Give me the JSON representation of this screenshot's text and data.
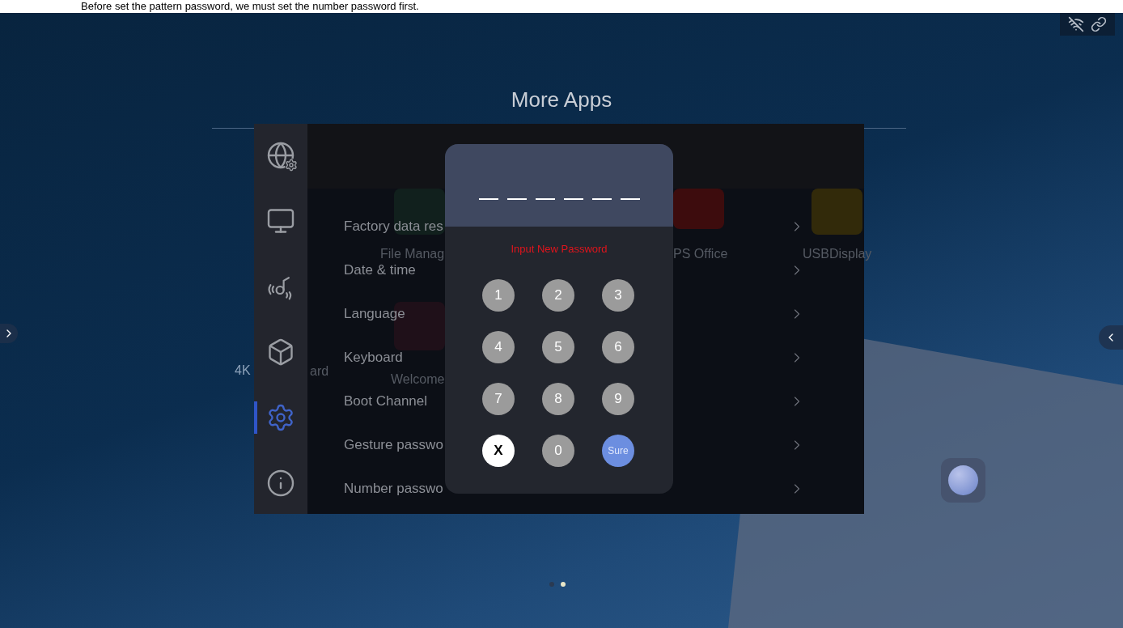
{
  "caption": "Before set the pattern password, we must set the number password first.",
  "screen": {
    "title": "More Apps",
    "background_apps": [
      {
        "label": "File Manag",
        "kind": "files"
      },
      {
        "label": "PS Office",
        "kind": "office"
      },
      {
        "label": "USBDisplay",
        "kind": "display"
      },
      {
        "label": "ard",
        "kind": "text"
      },
      {
        "label": "Welcome",
        "kind": "hand"
      }
    ],
    "wallpaper_label": "4K",
    "settings": {
      "sidebar": [
        {
          "kind": "network",
          "selected": false
        },
        {
          "kind": "display",
          "selected": false
        },
        {
          "kind": "sound",
          "selected": false
        },
        {
          "kind": "apps",
          "selected": false
        },
        {
          "kind": "system",
          "selected": true
        },
        {
          "kind": "about",
          "selected": false
        }
      ],
      "items": [
        "Factory data res",
        "Date & time",
        "Language",
        "Keyboard",
        "Boot Channel",
        "Gesture passwo",
        "Number passwo"
      ]
    },
    "dialog": {
      "prompt": "Input New Password",
      "keys": [
        {
          "label": "1",
          "kind": "digit"
        },
        {
          "label": "2",
          "kind": "digit"
        },
        {
          "label": "3",
          "kind": "digit"
        },
        {
          "label": "4",
          "kind": "digit"
        },
        {
          "label": "5",
          "kind": "digit"
        },
        {
          "label": "6",
          "kind": "digit"
        },
        {
          "label": "7",
          "kind": "digit"
        },
        {
          "label": "8",
          "kind": "digit"
        },
        {
          "label": "9",
          "kind": "digit"
        },
        {
          "label": "X",
          "kind": "clear"
        },
        {
          "label": "0",
          "kind": "digit"
        },
        {
          "label": "Sure",
          "kind": "confirm"
        }
      ]
    },
    "pages": [
      {
        "selected": false
      },
      {
        "selected": true
      }
    ]
  }
}
